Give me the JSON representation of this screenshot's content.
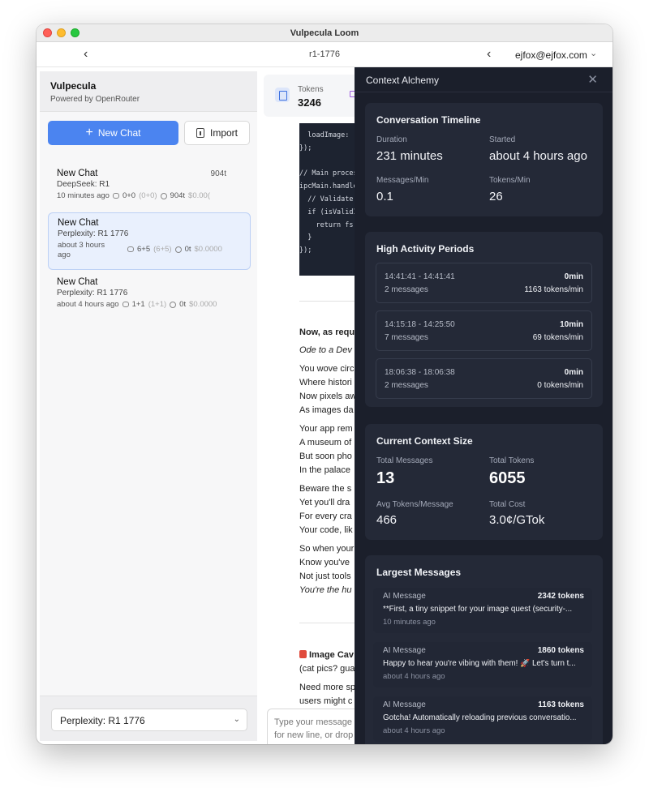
{
  "window": {
    "title": "Vulpecula Loom"
  },
  "nav": {
    "back": "‹",
    "conversation_id": "r1-1776",
    "back2": "‹",
    "user": "ejfox@ejfox.com",
    "chevron": "⌄"
  },
  "sidebar": {
    "title": "Vulpecula",
    "subtitle": "Powered by OpenRouter",
    "new_chat_label": "New Chat",
    "import_label": "Import",
    "chats": [
      {
        "title": "New Chat",
        "tokens": "904t",
        "model": "DeepSeek: R1",
        "time": "10 minutes ago",
        "count": "0+0",
        "count_detail": "(0+0)",
        "tok": "904t",
        "cost": "$0.00("
      },
      {
        "title": "New Chat",
        "tokens": "",
        "model": "Perplexity: R1 1776",
        "time_line1": "about 3 hours",
        "time_line2": "ago",
        "count": "6+5",
        "count_detail": "(6+5)",
        "tok": "0t",
        "cost": "$0.0000"
      },
      {
        "title": "New Chat",
        "tokens": "",
        "model": "Perplexity: R1 1776",
        "time": "about 4 hours ago",
        "count": "1+1",
        "count_detail": "(1+1)",
        "tok": "0t",
        "cost": "$0.0000"
      }
    ],
    "model_select": "Perplexity: R1 1776"
  },
  "main": {
    "tokens_label": "Tokens",
    "tokens_value": "3246",
    "code_lines": [
      "  loadImage: (",
      "});",
      "",
      "// Main proces",
      "ipcMain.handle",
      "  // Validate ",
      "  if (isValidI",
      "    return fs.",
      "  }",
      "});"
    ],
    "lines": [
      {
        "text": "Now, as requ",
        "style": "b"
      },
      {
        "text": "Ode to a Dev",
        "style": "i"
      },
      {
        "text": "You wove circ",
        "style": ""
      },
      {
        "text": "Where histori",
        "style": ""
      },
      {
        "text": "Now pixels aw",
        "style": ""
      },
      {
        "text": "As images da",
        "style": ""
      },
      {
        "text": "Your app rem",
        "style": ""
      },
      {
        "text": "A museum of",
        "style": ""
      },
      {
        "text": "But soon pho",
        "style": ""
      },
      {
        "text": "In the palace",
        "style": ""
      },
      {
        "text": "Beware the s",
        "style": ""
      },
      {
        "text": "Yet you'll dra",
        "style": ""
      },
      {
        "text": "For every cra",
        "style": ""
      },
      {
        "text": "Your code, lik",
        "style": ""
      },
      {
        "text": "So when your",
        "style": ""
      },
      {
        "text": "Know you've",
        "style": ""
      },
      {
        "text": "Not just tools",
        "style": ""
      },
      {
        "text": "You're the hu",
        "style": "i"
      }
    ],
    "image_heading": "Image Cav",
    "image_sub": "(cat pics? gua",
    "need_line1": "Need more sp",
    "need_line2": "users might c",
    "input_placeholder_1": "Type your message",
    "input_placeholder_2": "for new line, or drop"
  },
  "panel": {
    "title": "Context Alchemy",
    "close": "✕",
    "timeline": {
      "heading": "Conversation Timeline",
      "duration_label": "Duration",
      "duration": "231 minutes",
      "started_label": "Started",
      "started": "about 4 hours ago",
      "mpm_label": "Messages/Min",
      "mpm": "0.1",
      "tpm_label": "Tokens/Min",
      "tpm": "26"
    },
    "activity": {
      "heading": "High Activity Periods",
      "periods": [
        {
          "range": "14:41:41 - 14:41:41",
          "duration": "0min",
          "messages": "2 messages",
          "rate": "1163 tokens/min"
        },
        {
          "range": "14:15:18 - 14:25:50",
          "duration": "10min",
          "messages": "7 messages",
          "rate": "69 tokens/min"
        },
        {
          "range": "18:06:38 - 18:06:38",
          "duration": "0min",
          "messages": "2 messages",
          "rate": "0 tokens/min"
        }
      ]
    },
    "context": {
      "heading": "Current Context Size",
      "total_messages_label": "Total Messages",
      "total_messages": "13",
      "total_tokens_label": "Total Tokens",
      "total_tokens": "6055",
      "avg_label": "Avg Tokens/Message",
      "avg": "466",
      "cost_label": "Total Cost",
      "cost": "3.0¢/GTok"
    },
    "largest": {
      "heading": "Largest Messages",
      "items": [
        {
          "kind": "AI Message",
          "tokens": "2342 tokens",
          "preview": "**First, a tiny snippet for your image quest (security-...",
          "age": "10 minutes ago"
        },
        {
          "kind": "AI Message",
          "tokens": "1860 tokens",
          "preview": "Happy to hear you're vibing with them! 🚀 Let's turn t...",
          "age": "about 4 hours ago"
        },
        {
          "kind": "AI Message",
          "tokens": "1163 tokens",
          "preview": "Gotcha! Automatically reloading previous conversatio...",
          "age": "about 4 hours ago"
        }
      ]
    }
  }
}
